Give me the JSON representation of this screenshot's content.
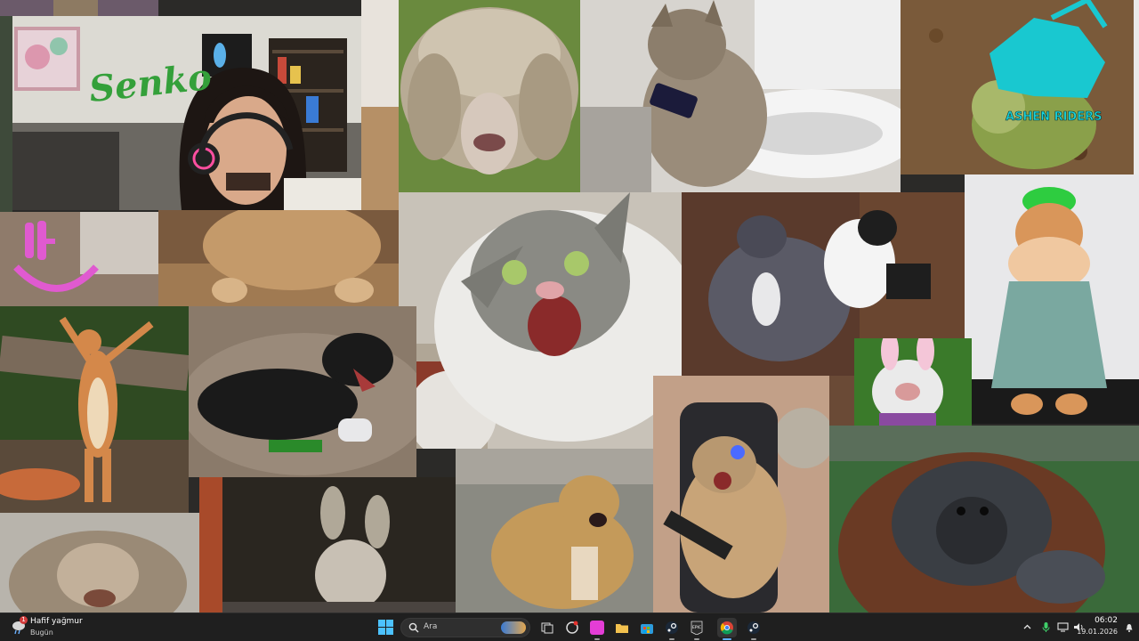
{
  "desktop": {
    "wallpaper": "animal meme collage",
    "stickers": {
      "ashen_riders_logo": "ASHEN RIDERS",
      "wall_sign": "Senko"
    }
  },
  "taskbar": {
    "weather": {
      "title": "Hafif yağmur",
      "subtitle": "Bugün",
      "badge": "1"
    },
    "start_icon": "windows-start-icon",
    "search": {
      "placeholder": "Ara"
    },
    "apps": [
      {
        "name": "task-view",
        "color": "#9e9e9e"
      },
      {
        "name": "copilot",
        "color": "#c8c8c8"
      },
      {
        "name": "media-app",
        "color": "#e43dd6"
      },
      {
        "name": "file-explorer",
        "color": "#f2c14e"
      },
      {
        "name": "microsoft-store",
        "color": "#2d9cdb"
      },
      {
        "name": "steam",
        "color": "#1b2838"
      },
      {
        "name": "epic-games",
        "color": "#2a2a2a"
      },
      {
        "name": "chrome",
        "color": "#4285f4"
      },
      {
        "name": "steam-2",
        "color": "#1b2838"
      }
    ],
    "tray": [
      "chevron-up-icon",
      "microphone-icon",
      "display-icon",
      "volume-icon"
    ],
    "clock": {
      "time": "06:02",
      "date": "19.01.2026"
    }
  },
  "colors": {
    "taskbar_bg": "#1f1f1f",
    "accent": "#60b0ff"
  }
}
